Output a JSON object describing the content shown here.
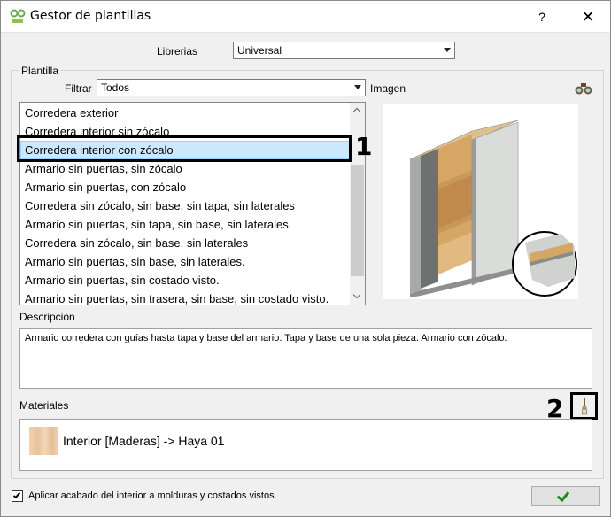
{
  "window": {
    "title": "Gestor de plantillas",
    "help_label": "?",
    "close_label": "✕"
  },
  "libraries": {
    "label": "Librerias",
    "selected": "Universal"
  },
  "template_group": {
    "title": "Plantilla",
    "filter_label": "Filtrar",
    "filter_selected": "Todos",
    "image_label": "Imagen",
    "items": [
      "Corredera exterior",
      "Corredera interior sin zócalo",
      "Corredera interior con zócalo",
      "Armario sin puertas, sin zócalo",
      "Armario sin puertas, con zócalo",
      "Corredera sin zócalo, sin base, sin tapa, sin laterales",
      "Armario sin puertas, sin tapa, sin base, sin laterales.",
      "Corredera sin zócalo, sin base, sin laterales",
      "Armario sin puertas, sin base, sin laterales.",
      "Armario sin puertas, sin costado visto.",
      "Armario sin puertas, sin trasera, sin base, sin costado visto."
    ],
    "selected_index": 2
  },
  "description": {
    "label": "Descripción",
    "text": "Armario corredera con guías hasta tapa y base del armario. Tapa y base de una sola pieza. Armario con zócalo."
  },
  "materials": {
    "label": "Materiales",
    "item": "Interior [Maderas] -> Haya 01"
  },
  "annotations": {
    "callout_1": "1",
    "callout_2": "2"
  },
  "footer": {
    "checkbox_label": "Aplicar acabado del interior a molduras y costados vistos.",
    "checkbox_checked": true
  },
  "colors": {
    "selection_bg": "#cce8ff",
    "ok_check": "#1a8a1a"
  }
}
